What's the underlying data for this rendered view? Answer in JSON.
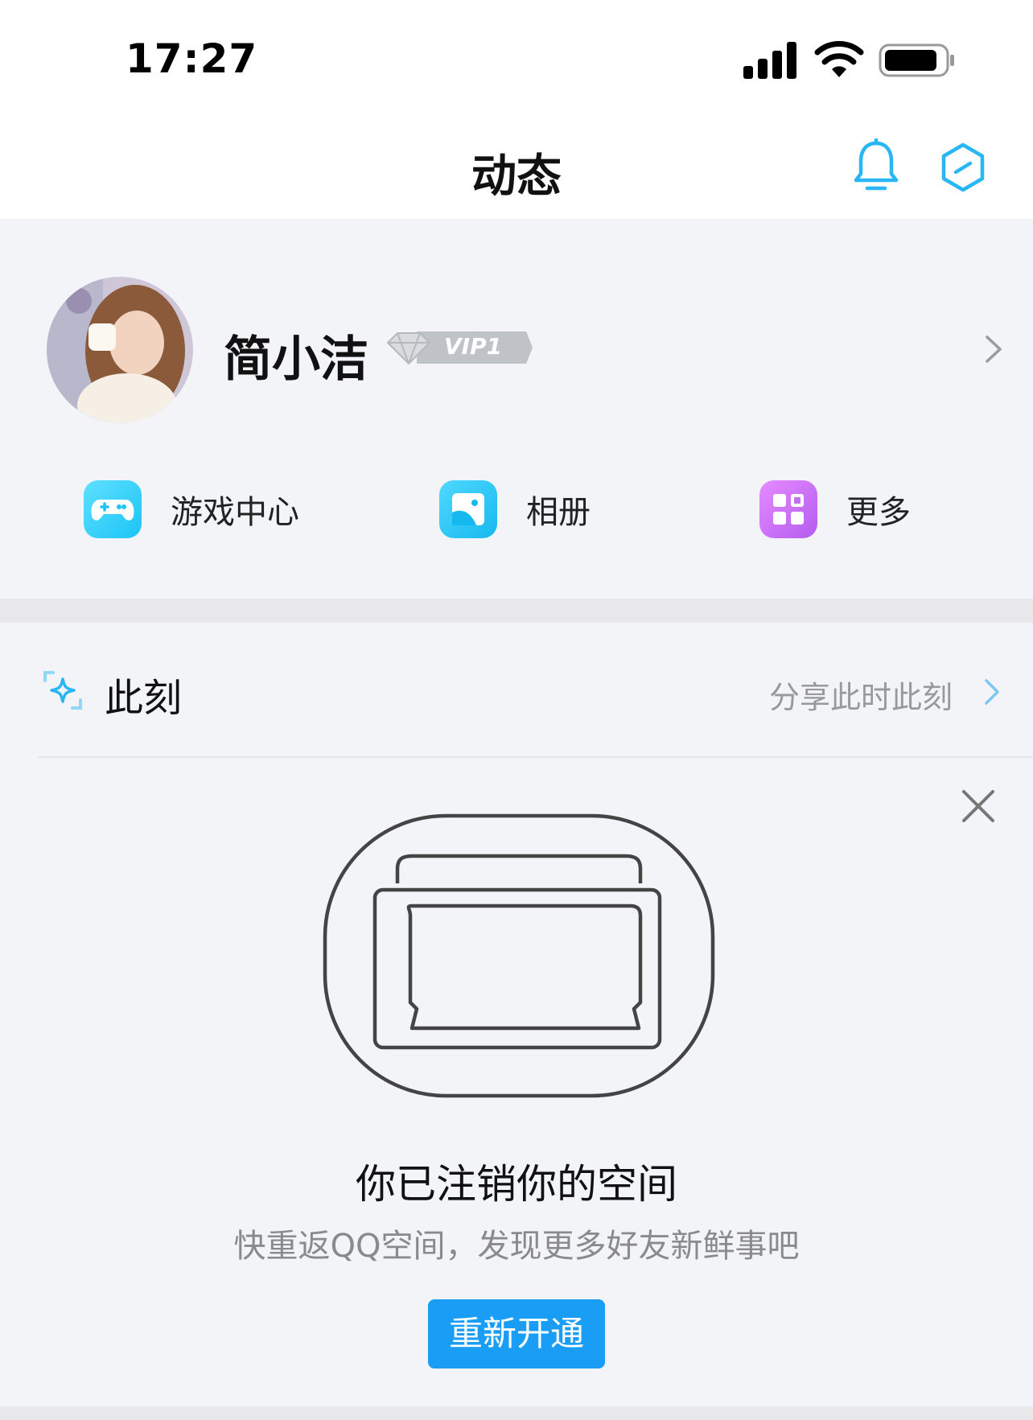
{
  "status_bar": {
    "time": "17:27",
    "icons": [
      "cellular-signal-icon",
      "wifi-icon",
      "battery-icon"
    ]
  },
  "nav": {
    "title": "动态",
    "right_icons": [
      "bell-icon",
      "hexagon-settings-icon"
    ]
  },
  "profile": {
    "name": "简小洁",
    "vip_badge": "VIP1",
    "quick_actions": [
      {
        "label": "游戏中心",
        "icon": "gamepad-icon",
        "color": "#1cc4f6"
      },
      {
        "label": "相册",
        "icon": "album-icon",
        "color": "#16b9ef"
      },
      {
        "label": "更多",
        "icon": "grid-more-icon",
        "color": "#b45cf0"
      }
    ]
  },
  "moment": {
    "title": "此刻",
    "share_link": "分享此时此刻"
  },
  "empty_state": {
    "title": "你已注销你的空间",
    "subtitle": "快重返QQ空间，发现更多好友新鲜事吧",
    "button": "重新开通"
  },
  "colors": {
    "accent": "#1a9df5",
    "icon_blue": "#29b6f6",
    "background": "#f3f4f8"
  }
}
